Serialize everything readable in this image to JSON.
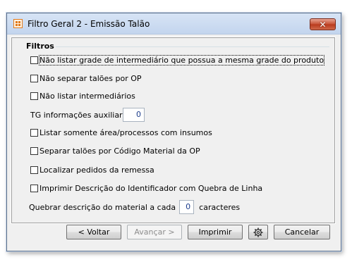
{
  "window": {
    "title": "Filtro Geral 2 - Emissão Talão",
    "close_glyph": "✕"
  },
  "group": {
    "title": "Filtros"
  },
  "options": [
    {
      "label": "Não listar grade de intermediário que possua a mesma grade do produto",
      "checked": false
    },
    {
      "label": "Não separar talões por OP",
      "checked": false
    },
    {
      "label": "Não listar intermediários",
      "checked": false
    },
    {
      "label": "Listar somente área/processos com insumos",
      "checked": false
    },
    {
      "label": "Separar talões por Código Material da OP",
      "checked": false
    },
    {
      "label": "Localizar pedidos da remessa",
      "checked": false
    },
    {
      "label": "Imprimir Descrição do Identificador com Quebra de Linha",
      "checked": false
    }
  ],
  "tg_info": {
    "label": "TG informações auxiliares",
    "value": "0"
  },
  "quebrar": {
    "label_before": "Quebrar descrição do material a cada",
    "value": "0",
    "label_after": "caracteres"
  },
  "buttons": {
    "voltar": "< Voltar",
    "avancar": "Avançar >",
    "imprimir": "Imprimir",
    "settings_icon": "gear-icon",
    "cancelar": "Cancelar"
  }
}
